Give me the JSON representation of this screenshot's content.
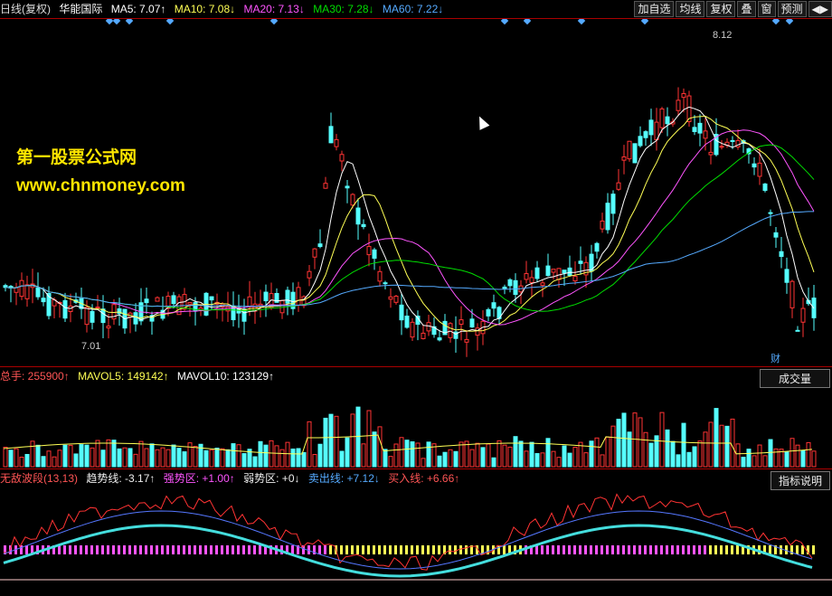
{
  "header": {
    "period": "日线(复权)",
    "stock_name": "华能国际",
    "ma": [
      {
        "label": "MA5: 7.07↑",
        "color": "#ffffff"
      },
      {
        "label": "MA10: 7.08↓",
        "color": "#ffff55"
      },
      {
        "label": "MA20: 7.13↓",
        "color": "#ff55ff"
      },
      {
        "label": "MA30: 7.28↓",
        "color": "#00dd00"
      },
      {
        "label": "MA60: 7.22↓",
        "color": "#55aaff"
      }
    ],
    "buttons": [
      "加自选",
      "均线",
      "复权",
      "叠",
      "窗",
      "预测",
      "◀▶"
    ]
  },
  "watermark": {
    "line1": "第一股票公式网",
    "line2": "www.chnmoney.com"
  },
  "price_panel": {
    "high_label": "8.12",
    "low_label": "7.01",
    "marker": "财"
  },
  "volume_panel": {
    "total": "总手: 255900↑",
    "mavol5": "MAVOL5: 149142↑",
    "mavol10": "MAVOL10: 123129↑",
    "tab": "成交量"
  },
  "indicator_panel": {
    "name": "无敌波段(13,13)",
    "items": [
      {
        "label": "趋势线: -3.17↑",
        "color": "#eeeeee"
      },
      {
        "label": "强势区: +1.00↑",
        "color": "#ff55ff"
      },
      {
        "label": "弱势区: +0↓",
        "color": "#eeeeee"
      },
      {
        "label": "卖出线: +7.12↓",
        "color": "#55aaff"
      },
      {
        "label": "买入线: +6.66↑",
        "color": "#ff5555"
      }
    ],
    "tab": "指标说明"
  },
  "colors": {
    "up": "#ff3333",
    "down": "#55ffff",
    "border": "#aa0000"
  },
  "chart_data": {
    "type": "candlestick",
    "y_max": 8.12,
    "y_min": 7.01,
    "note_values": [
      7.01,
      8.12
    ]
  }
}
